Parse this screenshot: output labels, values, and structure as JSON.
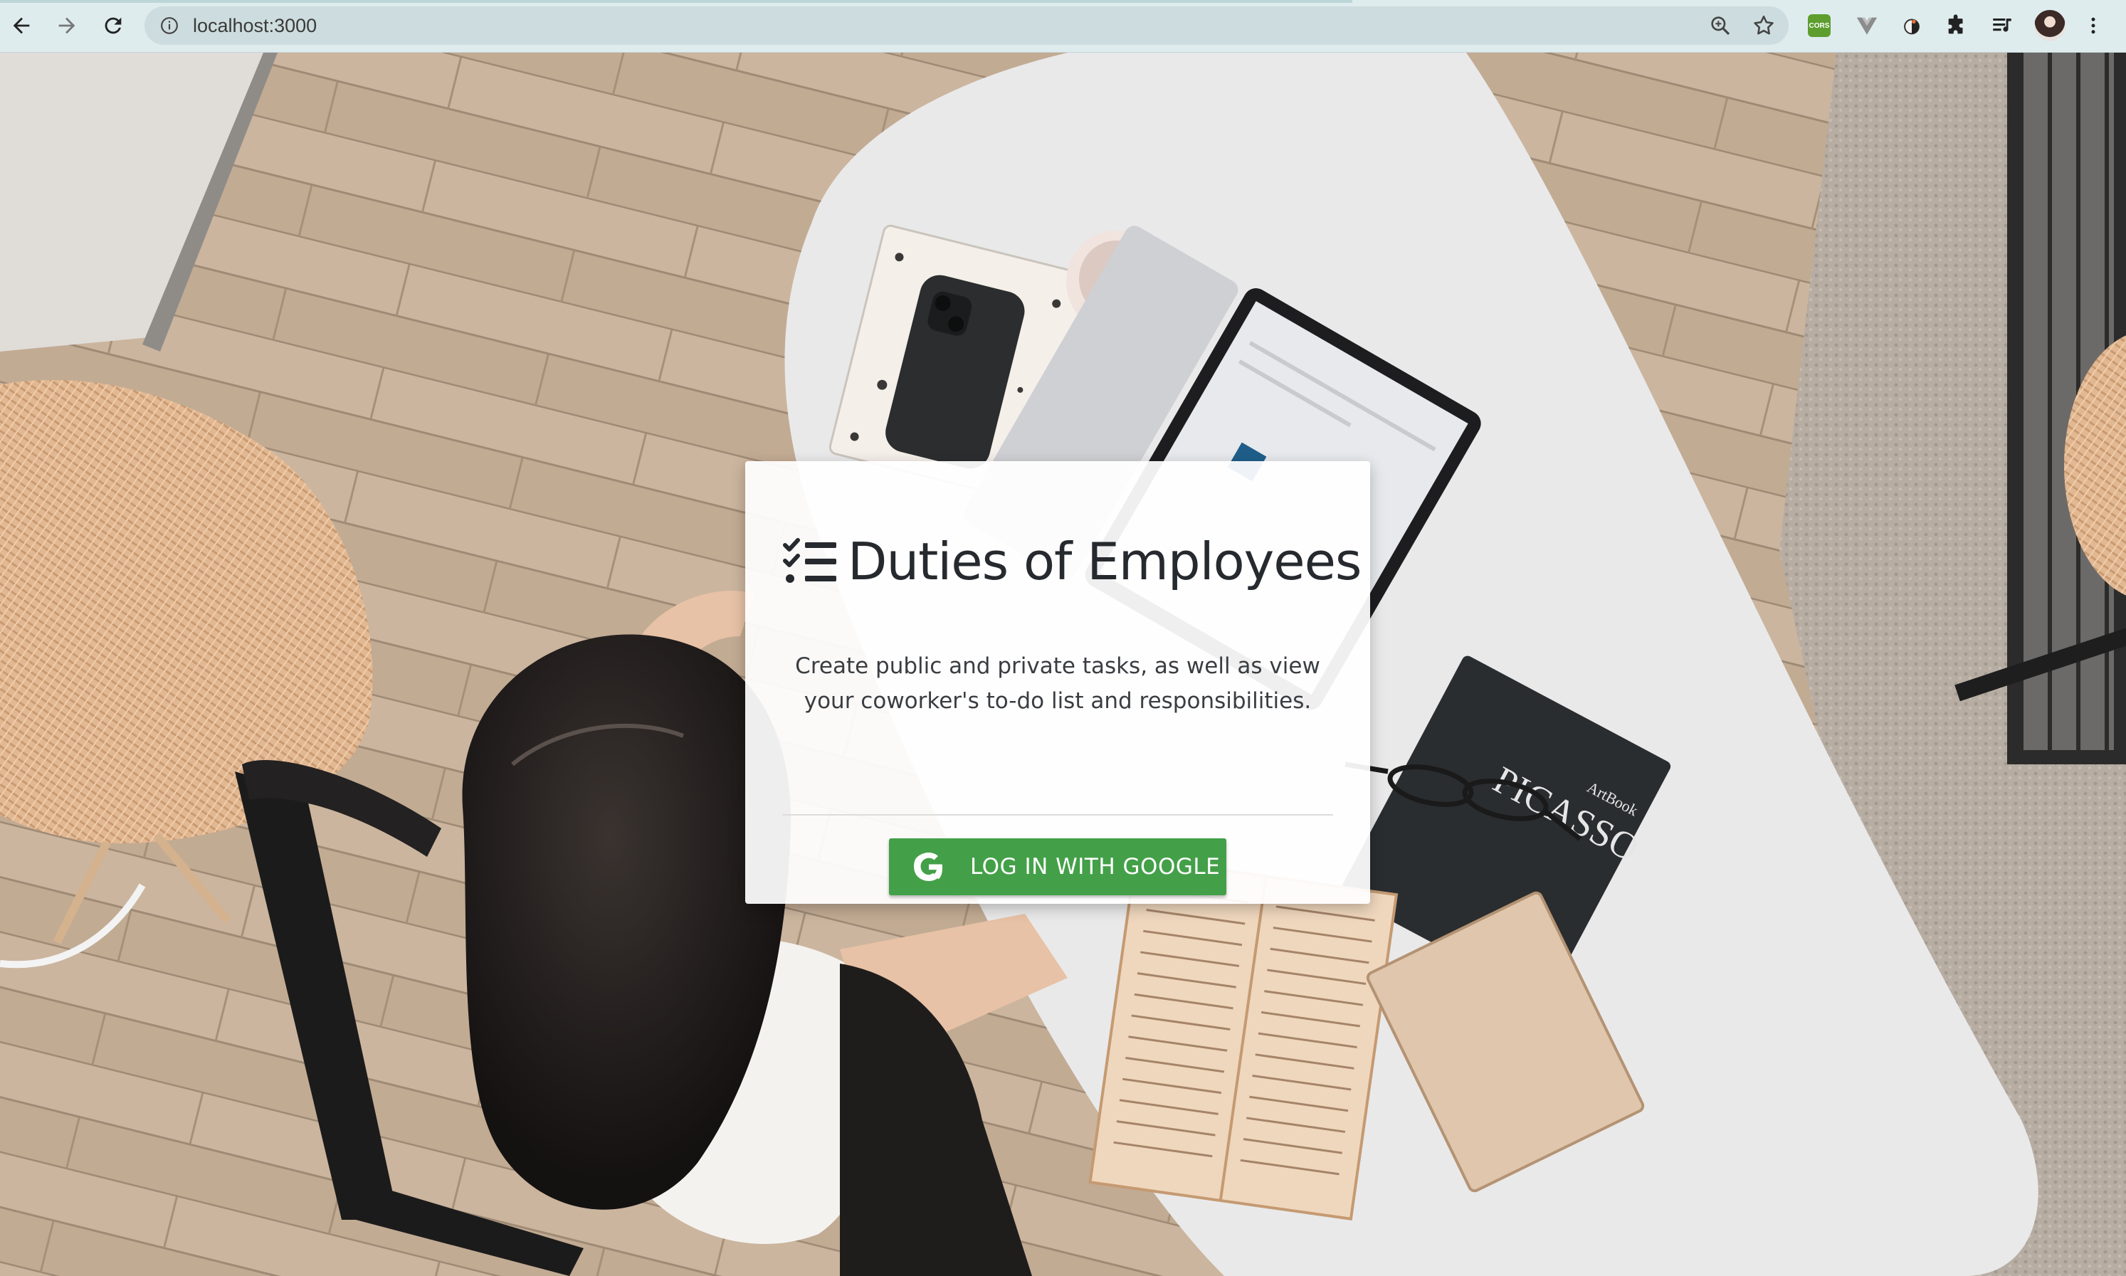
{
  "browser": {
    "url": "localhost:3000",
    "extensions": [
      {
        "name": "cors-extension",
        "label": "CORS"
      },
      {
        "name": "vue-devtools-extension"
      },
      {
        "name": "extension-three"
      },
      {
        "name": "extensions-menu"
      },
      {
        "name": "media-controls"
      }
    ]
  },
  "card": {
    "title": "Duties of Employees",
    "description": "Create public and private tasks, as well as view your coworker's to-do list and responsibilities.",
    "login_button_label": "LOG IN WITH GOOGLE"
  },
  "colors": {
    "button_green": "#43a048",
    "title_text": "#262a2f",
    "chrome_bg": "#dfecee"
  }
}
